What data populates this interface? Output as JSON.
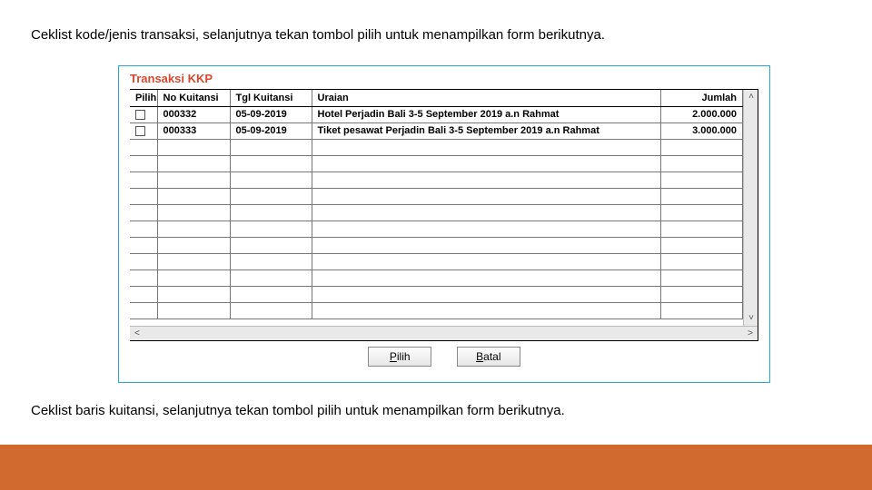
{
  "instructions": {
    "top": "Ceklist kode/jenis transaksi, selanjutnya tekan tombol pilih untuk menampilkan form berikutnya.",
    "bottom": "Ceklist baris kuitansi, selanjutnya tekan tombol pilih untuk menampilkan form berikutnya."
  },
  "window": {
    "title": "Transaksi KKP"
  },
  "table": {
    "headers": {
      "pilih": "Pilih",
      "no_kuitansi": "No Kuitansi",
      "tgl_kuitansi": "Tgl Kuitansi",
      "uraian": "Uraian",
      "jumlah": "Jumlah"
    },
    "rows": [
      {
        "no": "000332",
        "tgl": "05-09-2019",
        "uraian": "Hotel Perjadin Bali 3-5 September 2019 a.n Rahmat",
        "jumlah": "2.000.000"
      },
      {
        "no": "000333",
        "tgl": "05-09-2019",
        "uraian": "Tiket pesawat Perjadin Bali 3-5 September 2019 a.n Rahmat",
        "jumlah": "3.000.000"
      }
    ]
  },
  "buttons": {
    "pilih_u": "P",
    "pilih_rest": "ilih",
    "batal_u": "B",
    "batal_rest": "atal"
  }
}
